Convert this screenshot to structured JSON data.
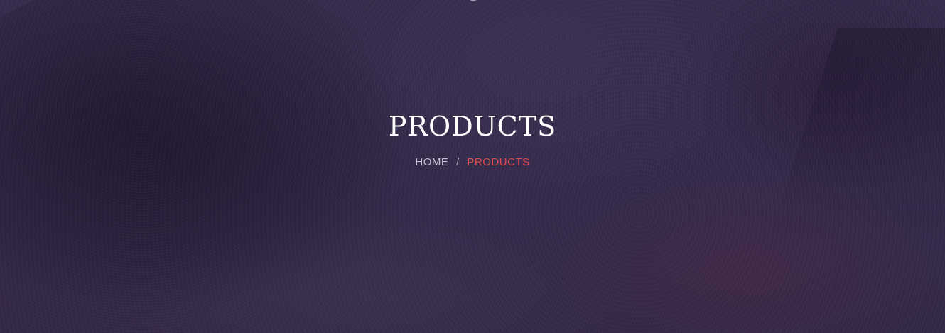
{
  "header": {
    "title": "PRODUCTS"
  },
  "breadcrumb": {
    "home": "HOME",
    "separator": "/",
    "current": "PRODUCTS"
  },
  "colors": {
    "title": "#ffffff",
    "breadcrumb_home": "#c9c4d3",
    "breadcrumb_current": "#e34b4f",
    "background": "#352b4b"
  }
}
